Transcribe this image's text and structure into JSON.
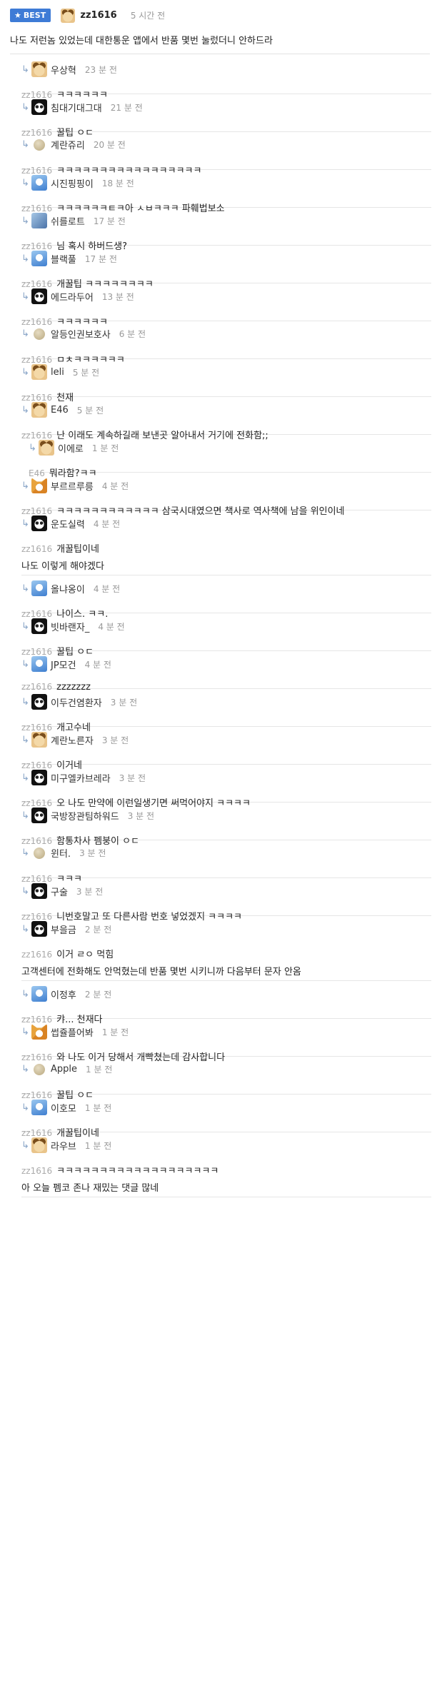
{
  "best": {
    "badge": "BEST",
    "nick": "zz1616",
    "time": "5 시간 전",
    "text": "나도 저런놈 있었는데 대한통운 앱에서 반품 몇번 눌렀더니 안하드라"
  },
  "comments": [
    {
      "avatar": "dog-icon",
      "nick": "우상혁",
      "time": "23 분 전",
      "mention": "zz1616",
      "text": "ㅋㅋㅋㅋㅋㅋ"
    },
    {
      "avatar": "panda-icon",
      "nick": "침대기대그대",
      "time": "21 분 전",
      "mention": "zz1616",
      "text": "꿀팁 ㅇㄷ"
    },
    {
      "avatar": "round-icon",
      "nick": "계란쥬리",
      "time": "20 분 전",
      "mention": "zz1616",
      "text": "ㅋㅋㅋㅋㅋㅋㅋㅋㅋㅋㅋㅋㅋㅋㅋㅋㅋ"
    },
    {
      "avatar": "blue-icon",
      "nick": "시진핑핑이",
      "time": "18 분 전",
      "mention": "zz1616",
      "text": "ㅋㅋㅋㅋㅋㅋㅌㅋ아 ㅅㅂㅋㅋㅋ 파훼법보소"
    },
    {
      "avatar": "roach-icon",
      "nick": "쉬를로트",
      "time": "17 분 전",
      "mention": "zz1616",
      "text": "님 혹시 하버드생?"
    },
    {
      "avatar": "blue-icon",
      "nick": "블랙풀",
      "time": "17 분 전",
      "mention": "zz1616",
      "text": "개꿀팁 ㅋㅋㅋㅋㅋㅋㅋㅋ"
    },
    {
      "avatar": "panda-icon",
      "nick": "에드라두어",
      "time": "13 분 전",
      "mention": "zz1616",
      "text": "ㅋㅋㅋㅋㅋㅋ"
    },
    {
      "avatar": "round-icon",
      "nick": "알등인권보호사",
      "time": "6 분 전",
      "mention": "zz1616",
      "text": "ㅁㅊㅋㅋㅋㅋㅋㅋ"
    },
    {
      "avatar": "dog-icon",
      "nick": "leli",
      "time": "5 분 전",
      "mention": "zz1616",
      "text": "천재"
    },
    {
      "avatar": "dog-icon",
      "nick": "E46",
      "time": "5 분 전",
      "mention": "zz1616",
      "text": "난 이래도 계속하길래 보낸곳 알아내서 거기에 전화함;;"
    },
    {
      "avatar": "dog-icon",
      "nick": "이에로",
      "time": "1 분 전",
      "mention": "E46",
      "text": "뭐라함?ㅋㅋ",
      "nested": true
    },
    {
      "avatar": "fox-icon",
      "nick": "부르르루릉",
      "time": "4 분 전",
      "mention": "zz1616",
      "text": "ㅋㅋㅋㅋㅋㅋㅋㅋㅋㅋㅋㅋ 삼국시대였으면 책사로 역사책에 남을 위인이네"
    },
    {
      "avatar": "panda-icon",
      "nick": "운도실력",
      "time": "4 분 전",
      "mention": "zz1616",
      "text": "개꿀팁이네",
      "extra": "나도 이렇게 해야겠다"
    },
    {
      "avatar": "blue-icon",
      "nick": "올냐옹이",
      "time": "4 분 전",
      "mention": "zz1616",
      "text": "나이스. ㅋㅋ."
    },
    {
      "avatar": "panda-icon",
      "nick": "빗바랜자_",
      "time": "4 분 전",
      "mention": "zz1616",
      "text": "꿀팁 ㅇㄷ"
    },
    {
      "avatar": "blue-icon",
      "nick": "JP모건",
      "time": "4 분 전",
      "mention": "zz1616",
      "text": "zzzzzzz"
    },
    {
      "avatar": "panda-icon",
      "nick": "이두건염환자",
      "time": "3 분 전",
      "mention": "zz1616",
      "text": "개고수네"
    },
    {
      "avatar": "dog-icon",
      "nick": "계란노른자",
      "time": "3 분 전",
      "mention": "zz1616",
      "text": "이거네"
    },
    {
      "avatar": "panda-icon",
      "nick": "미구엘카브레라",
      "time": "3 분 전",
      "mention": "zz1616",
      "text": "오 나도 만약에 이런일생기면 써먹어야지 ㅋㅋㅋㅋ"
    },
    {
      "avatar": "panda-icon",
      "nick": "국방장관팀하워드",
      "time": "3 분 전",
      "mention": "zz1616",
      "text": "함통차사 펨붕이 ㅇㄷ"
    },
    {
      "avatar": "round-icon",
      "nick": "윈터.",
      "time": "3 분 전",
      "mention": "zz1616",
      "text": "ㅋㅋㅋ"
    },
    {
      "avatar": "panda-icon",
      "nick": "구술",
      "time": "3 분 전",
      "mention": "zz1616",
      "text": "니번호말고 또 다른사람 번호 넣었겠지 ㅋㅋㅋㅋ"
    },
    {
      "avatar": "panda-icon",
      "nick": "부을금",
      "time": "2 분 전",
      "mention": "zz1616",
      "text": "이거 ㄹㅇ 먹힘",
      "extra": "고객센터에 전화해도 안먹혔는데 반품 몇번 시키니까 다음부터 문자 안옴"
    },
    {
      "avatar": "blue-icon",
      "nick": "이정후",
      "time": "2 분 전",
      "mention": "zz1616",
      "text": "캬... 천재다"
    },
    {
      "avatar": "fox-icon",
      "nick": "썹쥴플어봐",
      "time": "1 분 전",
      "mention": "zz1616",
      "text": "와 나도 이거 당해서 개빡쳤는데 감사합니다"
    },
    {
      "avatar": "round-icon",
      "nick": "Apple",
      "time": "1 분 전",
      "mention": "zz1616",
      "text": "꿀팁 ㅇㄷ"
    },
    {
      "avatar": "blue-icon",
      "nick": "이호모",
      "time": "1 분 전",
      "mention": "zz1616",
      "text": "개꿀팁이네"
    },
    {
      "avatar": "dog-icon",
      "nick": "라우브",
      "time": "1 분 전",
      "mention": "zz1616",
      "text": "ㅋㅋㅋㅋㅋㅋㅋㅋㅋㅋㅋㅋㅋㅋㅋㅋㅋㅋㅋ",
      "extra": "아 오늘 펨코 존나 재밌는 댓글 많네"
    }
  ]
}
